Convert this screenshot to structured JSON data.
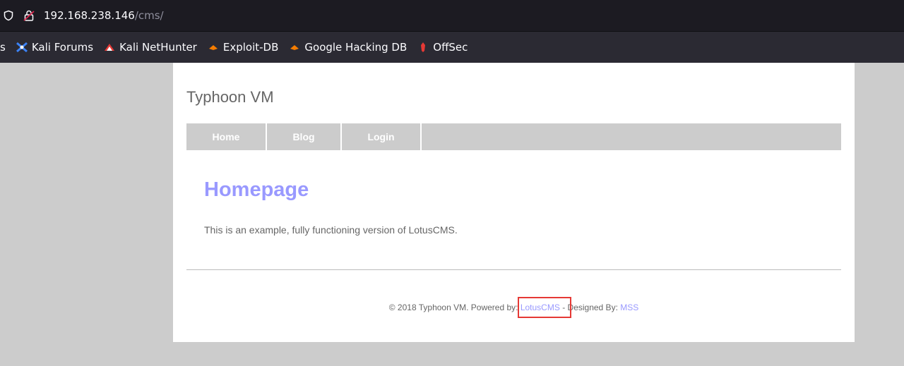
{
  "browser": {
    "url_host": "192.168.238.146",
    "url_path": "/cms/",
    "bookmarks": [
      {
        "label": "s",
        "icon": "none"
      },
      {
        "label": "Kali Forums",
        "icon": "kali-forums-icon"
      },
      {
        "label": "Kali NetHunter",
        "icon": "nethunter-icon"
      },
      {
        "label": "Exploit-DB",
        "icon": "exploit-db-icon"
      },
      {
        "label": "Google Hacking DB",
        "icon": "ghdb-icon"
      },
      {
        "label": "OffSec",
        "icon": "offsec-icon"
      }
    ]
  },
  "site": {
    "title": "Typhoon VM",
    "nav": [
      "Home",
      "Blog",
      "Login"
    ]
  },
  "content": {
    "heading": "Homepage",
    "text": "This is an example, fully functioning version of LotusCMS."
  },
  "footer": {
    "prefix": "© 2018 Typhoon VM. Powered by: ",
    "lotus_link": "LotusCMS",
    "middle": " - Designed By: ",
    "mss_link": "MSS"
  },
  "colors": {
    "accent": "#9999ff",
    "highlight": "#e53935",
    "nav_bg": "#cccccc"
  }
}
